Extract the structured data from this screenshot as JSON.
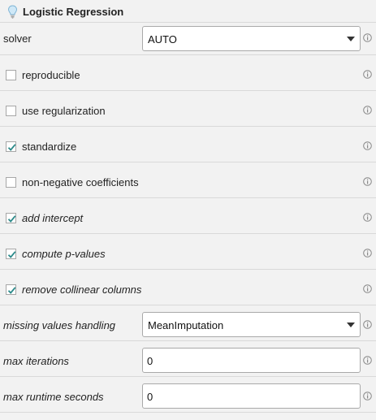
{
  "panel": {
    "title": "Logistic Regression",
    "icon": "lightbulb-icon"
  },
  "params": {
    "solver": {
      "label": "solver",
      "value": "AUTO"
    },
    "reproducible": {
      "label": "reproducible",
      "checked": false
    },
    "use_regularization": {
      "label": "use regularization",
      "checked": false
    },
    "standardize": {
      "label": "standardize",
      "checked": true
    },
    "non_negative": {
      "label": "non-negative coefficients",
      "checked": false
    },
    "add_intercept": {
      "label": "add intercept",
      "checked": true
    },
    "compute_p_values": {
      "label": "compute p-values",
      "checked": true
    },
    "remove_collinear": {
      "label": "remove collinear columns",
      "checked": true
    },
    "missing_values": {
      "label": "missing values handling",
      "value": "MeanImputation"
    },
    "max_iterations": {
      "label": "max iterations",
      "value": "0"
    },
    "max_runtime": {
      "label": "max runtime seconds",
      "value": "0"
    }
  },
  "colors": {
    "row_bg": "#f2f2f2",
    "divider": "#d9d9d9",
    "check": "#2b8a8a",
    "info_icon": "#8a8a8a"
  }
}
